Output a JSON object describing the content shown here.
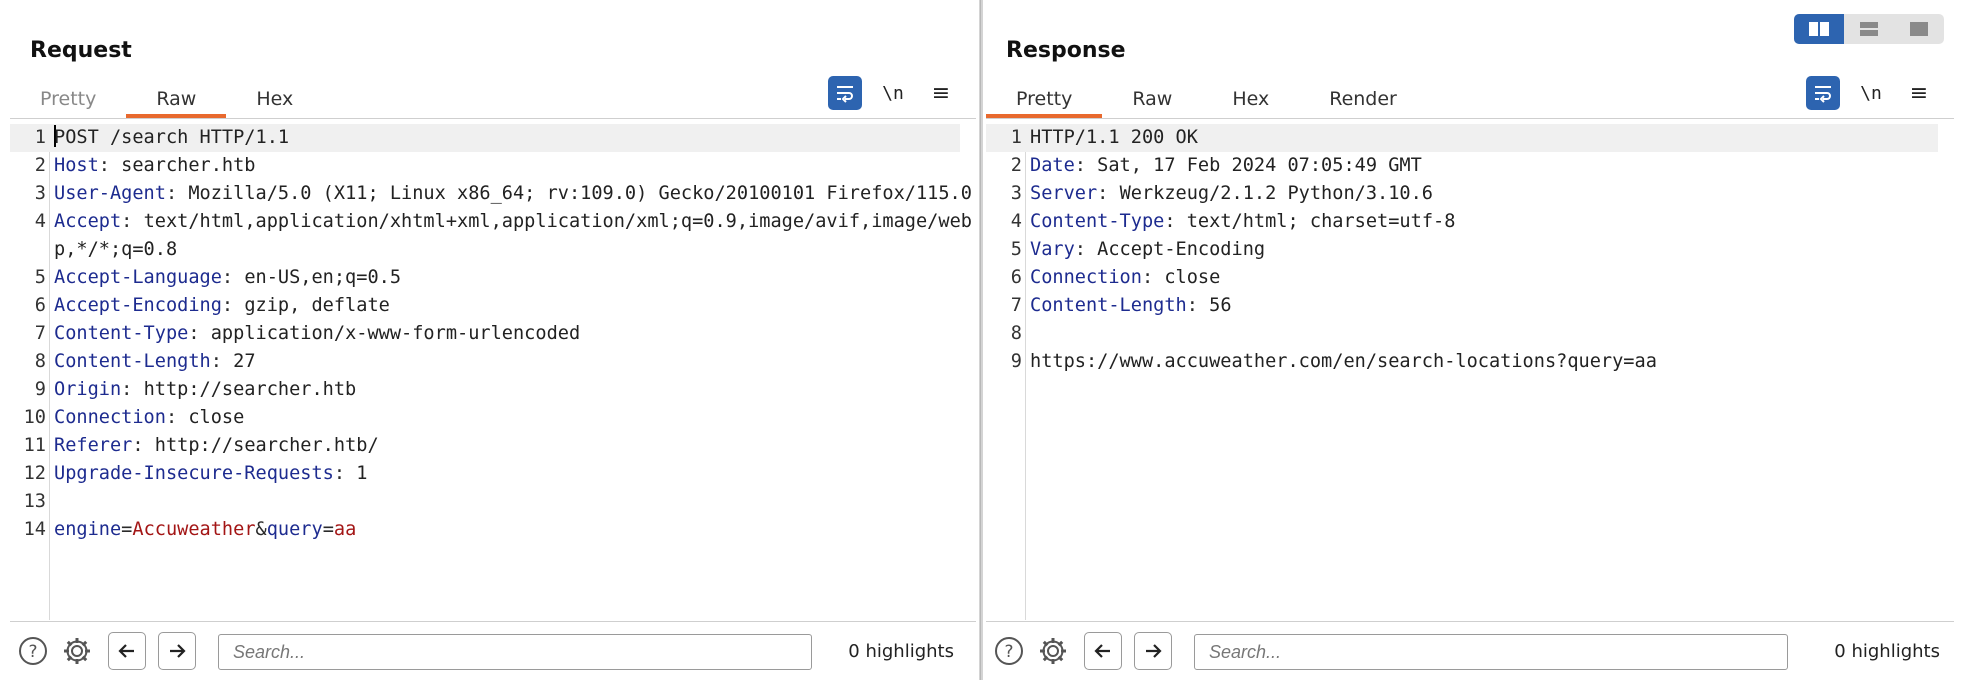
{
  "request": {
    "title": "Request",
    "tabs": [
      {
        "label": "Pretty",
        "state": "dim"
      },
      {
        "label": "Raw",
        "state": "active"
      },
      {
        "label": "Hex",
        "state": "normal"
      }
    ],
    "tools": {
      "newline_label": "\\n",
      "menu_glyph": "≡"
    },
    "lines": [
      {
        "n": "1",
        "text": "POST /search HTTP/1.1"
      },
      {
        "n": "2",
        "key": "Host",
        "sep": ": ",
        "value": "searcher.htb"
      },
      {
        "n": "3",
        "key": "User-Agent",
        "sep": ": ",
        "value": "Mozilla/5.0 (X11; Linux x86_64; rv:109.0) Gecko/20100101 Firefox/115.0"
      },
      {
        "n": "4",
        "key": "Accept",
        "sep": ":",
        "value": " text/html,application/xhtml+xml,application/xml;q=0.9,image/avif,image/webp,*/*;q=0.8"
      },
      {
        "n": "5",
        "key": "Accept-Language",
        "sep": ": ",
        "value": "en-US,en;q=0.5"
      },
      {
        "n": "6",
        "key": "Accept-Encoding",
        "sep": ": ",
        "value": "gzip, deflate"
      },
      {
        "n": "7",
        "key": "Content-Type",
        "sep": ": ",
        "value": "application/x-www-form-urlencoded"
      },
      {
        "n": "8",
        "key": "Content-Length",
        "sep": ": ",
        "value": "27"
      },
      {
        "n": "9",
        "key": "Origin",
        "sep": ": ",
        "value": "http://searcher.htb"
      },
      {
        "n": "10",
        "key": "Connection",
        "sep": ": ",
        "value": "close"
      },
      {
        "n": "11",
        "key": "Referer",
        "sep": ": ",
        "value": "http://searcher.htb/"
      },
      {
        "n": "12",
        "key": "Upgrade-Insecure-Requests",
        "sep": ": ",
        "value": "1"
      },
      {
        "n": "13",
        "text": ""
      },
      {
        "n": "14",
        "params": [
          {
            "name": "engine",
            "eq": "=",
            "val": "Accuweather",
            "amp": "&"
          },
          {
            "name": "query",
            "eq": "=",
            "val": "aa",
            "amp": ""
          }
        ]
      }
    ],
    "search_placeholder": "Search...",
    "highlights": "0 highlights"
  },
  "response": {
    "title": "Response",
    "tabs": [
      {
        "label": "Pretty",
        "state": "active"
      },
      {
        "label": "Raw",
        "state": "normal"
      },
      {
        "label": "Hex",
        "state": "normal"
      },
      {
        "label": "Render",
        "state": "normal"
      }
    ],
    "tools": {
      "newline_label": "\\n",
      "menu_glyph": "≡"
    },
    "lines": [
      {
        "n": "1",
        "text": "HTTP/1.1 200 OK"
      },
      {
        "n": "2",
        "key": "Date",
        "sep": ": ",
        "value": "Sat, 17 Feb 2024 07:05:49 GMT"
      },
      {
        "n": "3",
        "key": "Server",
        "sep": ": ",
        "value": "Werkzeug/2.1.2 Python/3.10.6"
      },
      {
        "n": "4",
        "key": "Content-Type",
        "sep": ": ",
        "value": "text/html; charset=utf-8"
      },
      {
        "n": "5",
        "key": "Vary",
        "sep": ": ",
        "value": "Accept-Encoding"
      },
      {
        "n": "6",
        "key": "Connection",
        "sep": ": ",
        "value": "close"
      },
      {
        "n": "7",
        "key": "Content-Length",
        "sep": ": ",
        "value": "56"
      },
      {
        "n": "8",
        "text": ""
      },
      {
        "n": "9",
        "text": "https://www.accuweather.com/en/search-locations?query=aa"
      }
    ],
    "search_placeholder": "Search...",
    "highlights": "0 highlights"
  },
  "layout_switch": {
    "options": [
      "side-by-side",
      "top-bottom",
      "single"
    ],
    "active": "side-by-side"
  },
  "colors": {
    "accent": "#e8692e",
    "button_blue": "#2d64b0",
    "header_key": "#1d2b8f",
    "param_value": "#a31515"
  }
}
